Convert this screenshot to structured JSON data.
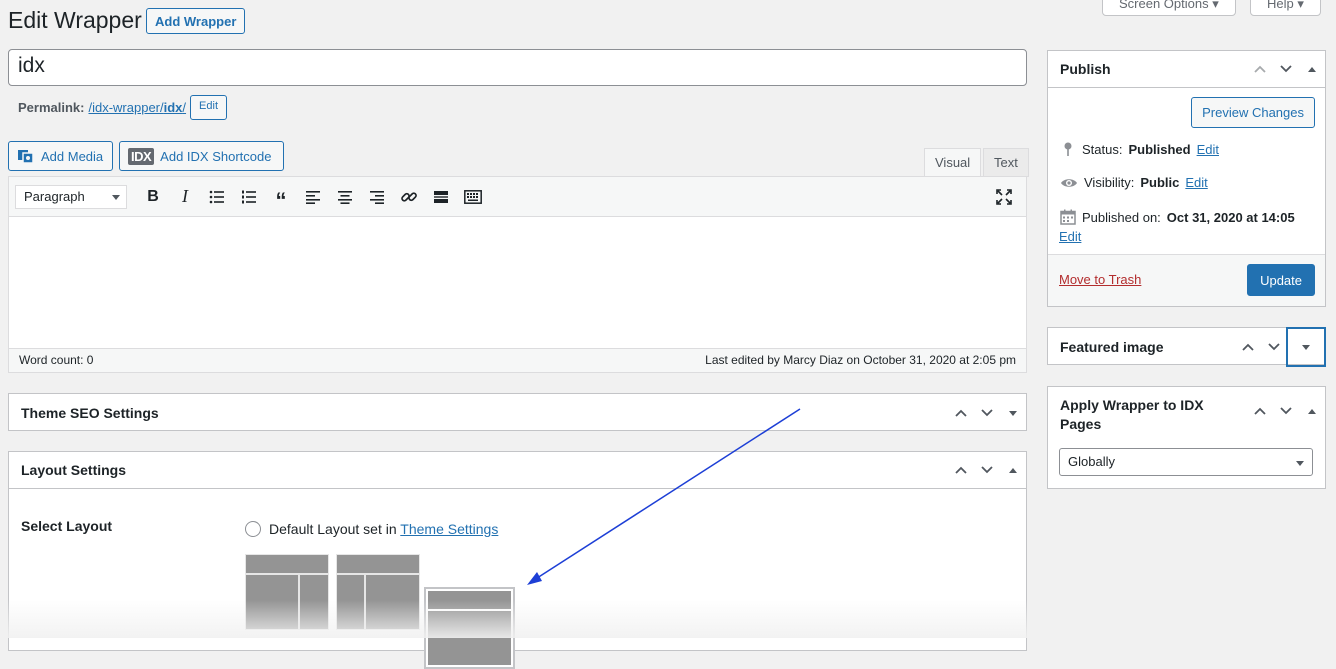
{
  "header": {
    "title": "Edit Wrapper",
    "add_button": "Add Wrapper",
    "screen_options": "Screen Options ▾",
    "help": "Help ▾"
  },
  "post": {
    "title_value": "idx",
    "permalink_label": "Permalink:",
    "permalink_prefix": "/idx-wrapper/",
    "permalink_slug": "idx",
    "permalink_suffix": "/",
    "edit_label": "Edit"
  },
  "media_buttons": {
    "add_media": "Add Media",
    "idx_logo": "IDX",
    "add_idx": "Add IDX Shortcode"
  },
  "editor": {
    "tabs": [
      "Visual",
      "Text"
    ],
    "format": "Paragraph",
    "word_count": "Word count: 0",
    "last_edited": "Last edited by Marcy Diaz on October 31, 2020 at 2:05 pm"
  },
  "boxes": {
    "seo": "Theme SEO Settings",
    "layout": "Layout Settings",
    "select_layout": "Select Layout",
    "default_layout_text": "Default Layout set in ",
    "theme_settings_link": "Theme Settings"
  },
  "publish": {
    "title": "Publish",
    "preview": "Preview Changes",
    "status_label": "Status:",
    "status_value": "Published",
    "visibility_label": "Visibility:",
    "visibility_value": "Public",
    "published_label": "Published on:",
    "published_value": "Oct 31, 2020 at 14:05",
    "edit": "Edit",
    "trash": "Move to Trash",
    "update": "Update"
  },
  "featured": {
    "title": "Featured image"
  },
  "apply_wrapper": {
    "title": "Apply Wrapper to IDX Pages",
    "selected": "Globally"
  },
  "colors": {
    "accent": "#2271b1",
    "annotation": "#1d3fd6"
  }
}
